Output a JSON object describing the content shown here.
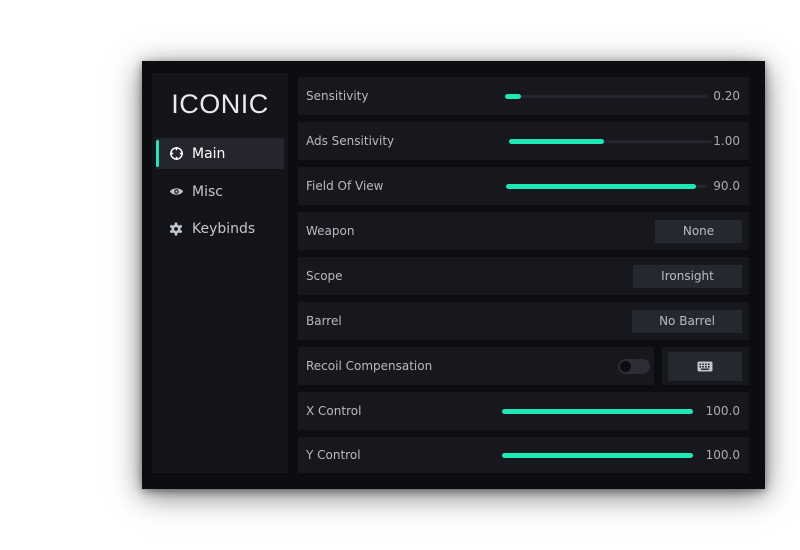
{
  "app": {
    "title": "ICONIC"
  },
  "sidebar": {
    "items": [
      {
        "label": "Main",
        "icon": "crosshair-icon",
        "active": true
      },
      {
        "label": "Misc",
        "icon": "eye-icon",
        "active": false
      },
      {
        "label": "Keybinds",
        "icon": "gear-icon",
        "active": false
      }
    ]
  },
  "settings": {
    "sensitivity": {
      "label": "Sensitivity",
      "value": "0.20",
      "level": 0.08
    },
    "ads_sensitivity": {
      "label": "Ads Sensitivity",
      "value": "1.00",
      "level": 0.47
    },
    "field_of_view": {
      "label": "Field Of View",
      "value": "90.0",
      "level": 0.95
    },
    "weapon": {
      "label": "Weapon",
      "selected": "None"
    },
    "scope": {
      "label": "Scope",
      "selected": "Ironsight"
    },
    "barrel": {
      "label": "Barrel",
      "selected": "No Barrel"
    },
    "recoil_compensation": {
      "label": "Recoil Compensation",
      "enabled": false,
      "keybind_icon": "keyboard-icon"
    },
    "x_control": {
      "label": "X Control",
      "value": "100.0",
      "level": 1.0
    },
    "y_control": {
      "label": "Y Control",
      "value": "100.0",
      "level": 1.0
    }
  },
  "colors": {
    "accent": "#1de9b6",
    "background": "#0c0d11",
    "panel": "#17181e",
    "sidebar": "#14151b"
  }
}
